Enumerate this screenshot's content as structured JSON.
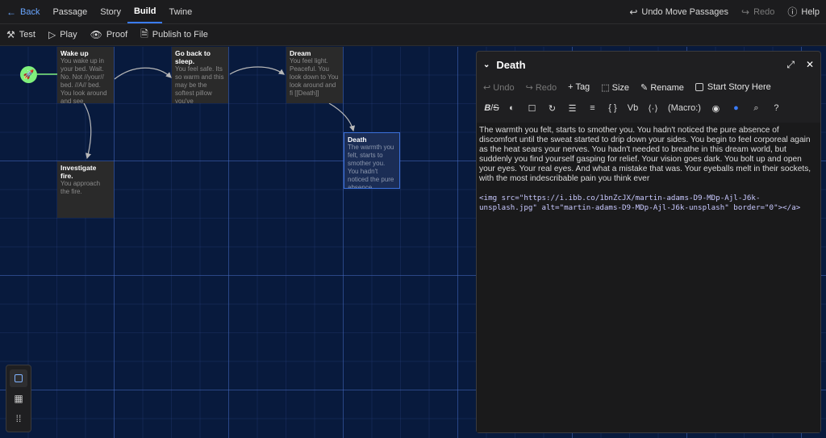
{
  "topbar": {
    "back": "Back",
    "tabs": [
      "Passage",
      "Story",
      "Build",
      "Twine"
    ],
    "active_tab": "Build",
    "undo": "Undo Move Passages",
    "redo": "Redo",
    "help": "Help"
  },
  "toolbar": {
    "test": "Test",
    "play": "Play",
    "proof": "Proof",
    "publish": "Publish to File"
  },
  "passages": [
    {
      "title": "Wake up",
      "excerpt": "You wake up in your bed. Wait. No. Not //your// bed. //A// bed. You look around and see"
    },
    {
      "title": "Go back to sleep.",
      "excerpt": "You feel safe. Its so warm and this may be the softest pillow you've"
    },
    {
      "title": "Dream",
      "excerpt": "You feel light. Peaceful. You look down to You look around and fi [[Death]]"
    },
    {
      "title": "Investigate fire.",
      "excerpt": "You approach the fire."
    },
    {
      "title": "Death",
      "excerpt": "The warmth you felt, starts to smother you. You hadn't noticed the pure absence"
    }
  ],
  "dialog": {
    "title": "Death",
    "undo": "Undo",
    "redo": "Redo",
    "tag": "Tag",
    "size": "Size",
    "rename": "Rename",
    "start_story": "Start Story Here",
    "macro": "(Macro:)",
    "vb": "Vb",
    "body": "The warmth you felt, starts to smother you. You hadn't noticed the pure absence of discomfort until the sweat started to drip down your sides. You begin to feel corporeal again as the heat sears your nerves. You hadn't needed to breathe in this dream world, but suddenly you find yourself gasping for relief. Your vision goes dark. You bolt up and open your eyes. Your real eyes. And what a mistake that was. Your eyeballs melt in their sockets, with the most indescribable pain you think ever",
    "code": "<img src=\"https://i.ibb.co/1bnZcJX/martin-adams-D9-MDp-Ajl-J6k-unsplash.jpg\" alt=\"martin-adams-D9-MDp-Ajl-J6k-unsplash\" border=\"0\"></a>"
  },
  "colors": {
    "accent": "#3a7cff",
    "start": "#7ff07c",
    "canvas": "#081a3d"
  }
}
